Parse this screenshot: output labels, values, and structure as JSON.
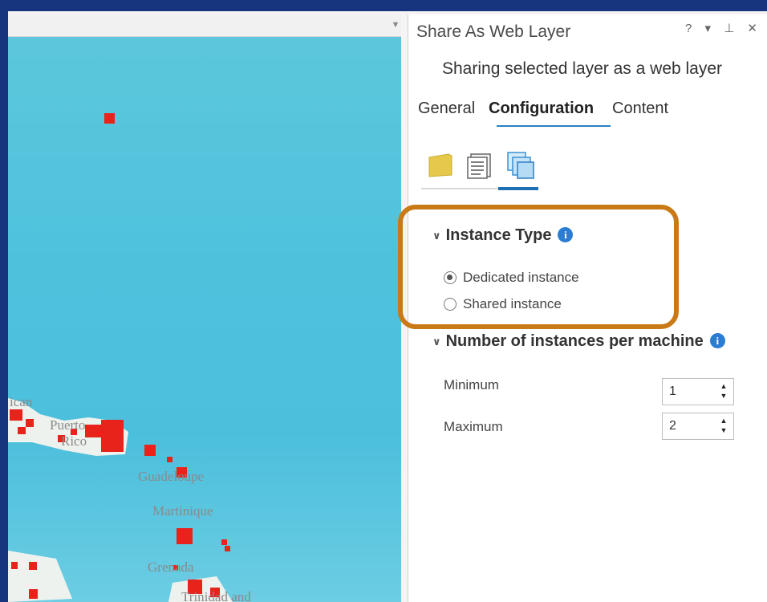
{
  "pane": {
    "title": "Share As Web Layer",
    "tools": "? ▾ ⊥ ✕",
    "subtitle": "Sharing selected layer as a web layer",
    "tabs": [
      {
        "label": "General"
      },
      {
        "label": "Configuration",
        "active": true
      },
      {
        "label": "Content"
      }
    ]
  },
  "instance_type": {
    "heading": "Instance Type",
    "options": [
      {
        "label": "Dedicated instance",
        "selected": true
      },
      {
        "label": "Shared instance",
        "selected": false
      }
    ]
  },
  "instances_per_machine": {
    "heading": "Number of instances per machine",
    "minimum_label": "Minimum",
    "minimum_value": "1",
    "maximum_label": "Maximum",
    "maximum_value": "2"
  },
  "map": {
    "labels": {
      "partial_top": "ican",
      "puerto": "Puerto",
      "rico": "Rico",
      "guadeloupe": "Guadeloupe",
      "martinique": "Martinique",
      "grenada": "Grenada",
      "trinidad": "Trinidad and"
    }
  },
  "colors": {
    "accent": "#1f6fb5",
    "highlight": "#c97a16",
    "marker": "#e8231b",
    "background": "#17357f"
  }
}
